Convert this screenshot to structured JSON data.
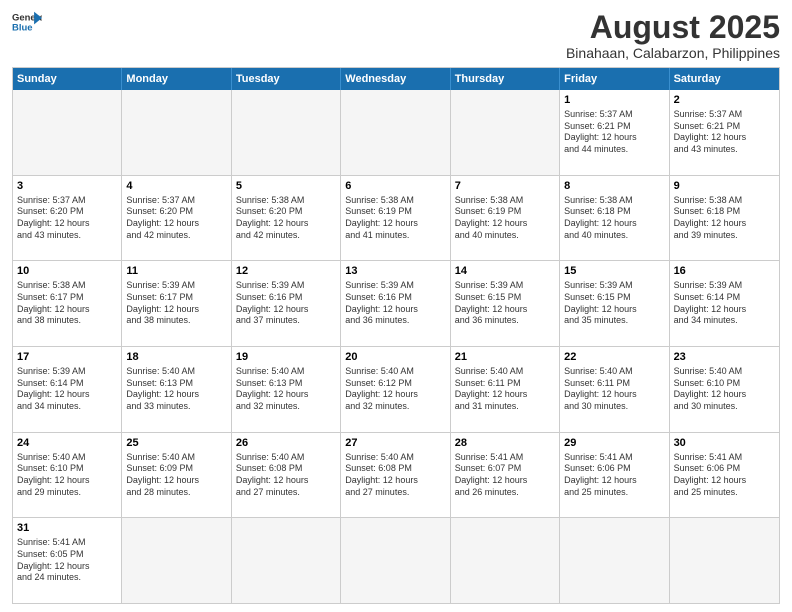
{
  "header": {
    "logo_line1": "General",
    "logo_line2": "Blue",
    "main_title": "August 2025",
    "subtitle": "Binahaan, Calabarzon, Philippines"
  },
  "days_of_week": [
    "Sunday",
    "Monday",
    "Tuesday",
    "Wednesday",
    "Thursday",
    "Friday",
    "Saturday"
  ],
  "weeks": [
    [
      {
        "day": "",
        "empty": true
      },
      {
        "day": "",
        "empty": true
      },
      {
        "day": "",
        "empty": true
      },
      {
        "day": "",
        "empty": true
      },
      {
        "day": "",
        "empty": true
      },
      {
        "day": "1",
        "info": "Sunrise: 5:37 AM\nSunset: 6:21 PM\nDaylight: 12 hours\nand 44 minutes."
      },
      {
        "day": "2",
        "info": "Sunrise: 5:37 AM\nSunset: 6:21 PM\nDaylight: 12 hours\nand 43 minutes."
      }
    ],
    [
      {
        "day": "3",
        "info": "Sunrise: 5:37 AM\nSunset: 6:20 PM\nDaylight: 12 hours\nand 43 minutes."
      },
      {
        "day": "4",
        "info": "Sunrise: 5:37 AM\nSunset: 6:20 PM\nDaylight: 12 hours\nand 42 minutes."
      },
      {
        "day": "5",
        "info": "Sunrise: 5:38 AM\nSunset: 6:20 PM\nDaylight: 12 hours\nand 42 minutes."
      },
      {
        "day": "6",
        "info": "Sunrise: 5:38 AM\nSunset: 6:19 PM\nDaylight: 12 hours\nand 41 minutes."
      },
      {
        "day": "7",
        "info": "Sunrise: 5:38 AM\nSunset: 6:19 PM\nDaylight: 12 hours\nand 40 minutes."
      },
      {
        "day": "8",
        "info": "Sunrise: 5:38 AM\nSunset: 6:18 PM\nDaylight: 12 hours\nand 40 minutes."
      },
      {
        "day": "9",
        "info": "Sunrise: 5:38 AM\nSunset: 6:18 PM\nDaylight: 12 hours\nand 39 minutes."
      }
    ],
    [
      {
        "day": "10",
        "info": "Sunrise: 5:38 AM\nSunset: 6:17 PM\nDaylight: 12 hours\nand 38 minutes."
      },
      {
        "day": "11",
        "info": "Sunrise: 5:39 AM\nSunset: 6:17 PM\nDaylight: 12 hours\nand 38 minutes."
      },
      {
        "day": "12",
        "info": "Sunrise: 5:39 AM\nSunset: 6:16 PM\nDaylight: 12 hours\nand 37 minutes."
      },
      {
        "day": "13",
        "info": "Sunrise: 5:39 AM\nSunset: 6:16 PM\nDaylight: 12 hours\nand 36 minutes."
      },
      {
        "day": "14",
        "info": "Sunrise: 5:39 AM\nSunset: 6:15 PM\nDaylight: 12 hours\nand 36 minutes."
      },
      {
        "day": "15",
        "info": "Sunrise: 5:39 AM\nSunset: 6:15 PM\nDaylight: 12 hours\nand 35 minutes."
      },
      {
        "day": "16",
        "info": "Sunrise: 5:39 AM\nSunset: 6:14 PM\nDaylight: 12 hours\nand 34 minutes."
      }
    ],
    [
      {
        "day": "17",
        "info": "Sunrise: 5:39 AM\nSunset: 6:14 PM\nDaylight: 12 hours\nand 34 minutes."
      },
      {
        "day": "18",
        "info": "Sunrise: 5:40 AM\nSunset: 6:13 PM\nDaylight: 12 hours\nand 33 minutes."
      },
      {
        "day": "19",
        "info": "Sunrise: 5:40 AM\nSunset: 6:13 PM\nDaylight: 12 hours\nand 32 minutes."
      },
      {
        "day": "20",
        "info": "Sunrise: 5:40 AM\nSunset: 6:12 PM\nDaylight: 12 hours\nand 32 minutes."
      },
      {
        "day": "21",
        "info": "Sunrise: 5:40 AM\nSunset: 6:11 PM\nDaylight: 12 hours\nand 31 minutes."
      },
      {
        "day": "22",
        "info": "Sunrise: 5:40 AM\nSunset: 6:11 PM\nDaylight: 12 hours\nand 30 minutes."
      },
      {
        "day": "23",
        "info": "Sunrise: 5:40 AM\nSunset: 6:10 PM\nDaylight: 12 hours\nand 30 minutes."
      }
    ],
    [
      {
        "day": "24",
        "info": "Sunrise: 5:40 AM\nSunset: 6:10 PM\nDaylight: 12 hours\nand 29 minutes."
      },
      {
        "day": "25",
        "info": "Sunrise: 5:40 AM\nSunset: 6:09 PM\nDaylight: 12 hours\nand 28 minutes."
      },
      {
        "day": "26",
        "info": "Sunrise: 5:40 AM\nSunset: 6:08 PM\nDaylight: 12 hours\nand 27 minutes."
      },
      {
        "day": "27",
        "info": "Sunrise: 5:40 AM\nSunset: 6:08 PM\nDaylight: 12 hours\nand 27 minutes."
      },
      {
        "day": "28",
        "info": "Sunrise: 5:41 AM\nSunset: 6:07 PM\nDaylight: 12 hours\nand 26 minutes."
      },
      {
        "day": "29",
        "info": "Sunrise: 5:41 AM\nSunset: 6:06 PM\nDaylight: 12 hours\nand 25 minutes."
      },
      {
        "day": "30",
        "info": "Sunrise: 5:41 AM\nSunset: 6:06 PM\nDaylight: 12 hours\nand 25 minutes."
      }
    ],
    [
      {
        "day": "31",
        "info": "Sunrise: 5:41 AM\nSunset: 6:05 PM\nDaylight: 12 hours\nand 24 minutes."
      },
      {
        "day": "",
        "empty": true
      },
      {
        "day": "",
        "empty": true
      },
      {
        "day": "",
        "empty": true
      },
      {
        "day": "",
        "empty": true
      },
      {
        "day": "",
        "empty": true
      },
      {
        "day": "",
        "empty": true
      }
    ]
  ]
}
